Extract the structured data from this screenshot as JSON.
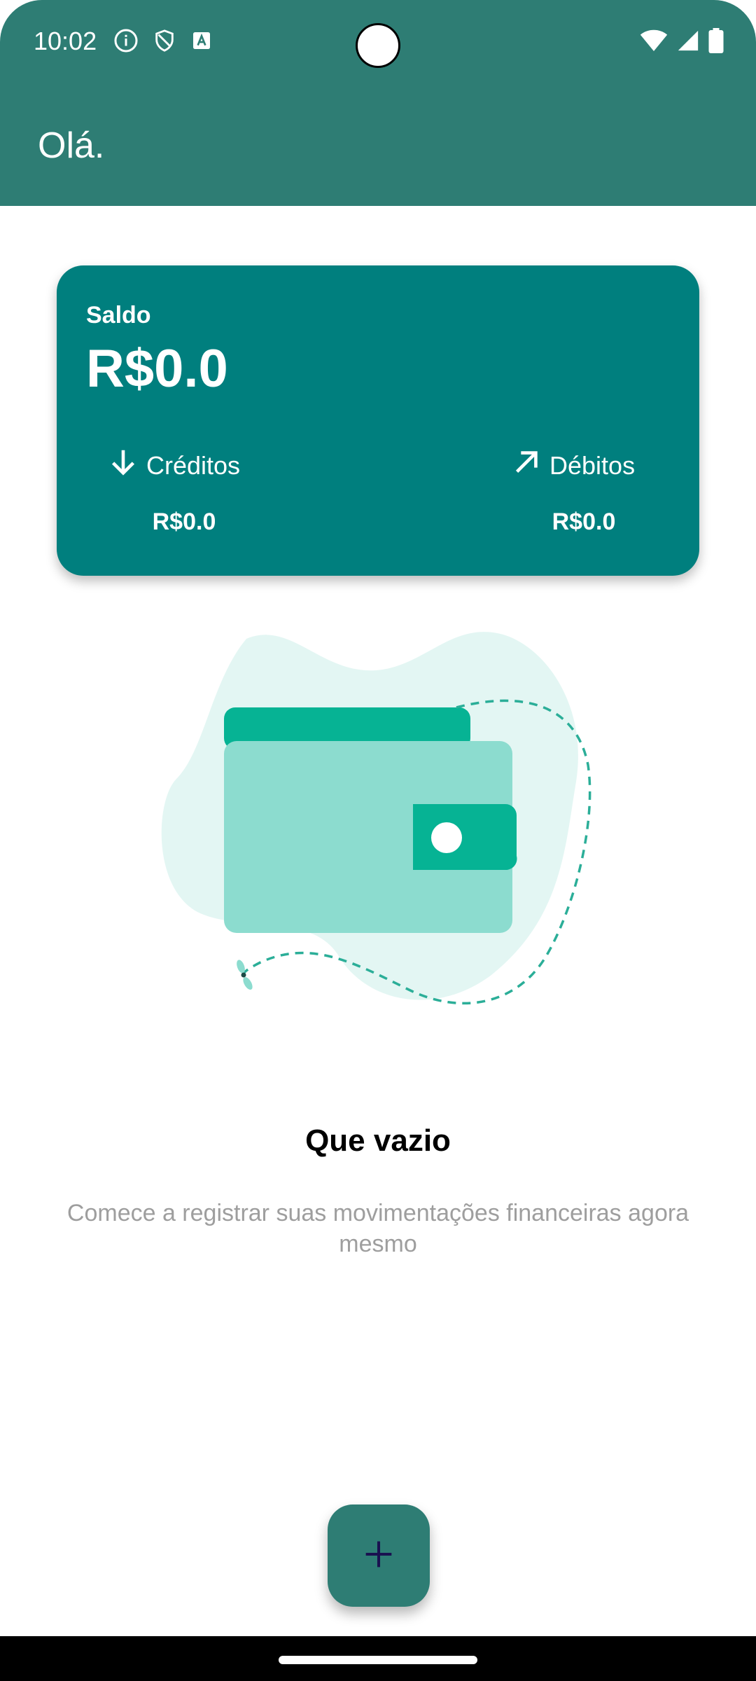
{
  "status_bar": {
    "time": "10:02",
    "left_icons": [
      "info-icon",
      "shield-icon",
      "text-a-icon"
    ],
    "right_icons": [
      "wifi-icon",
      "cell-signal-icon",
      "battery-icon"
    ]
  },
  "app_bar": {
    "title": "Olá."
  },
  "balance_card": {
    "label": "Saldo",
    "value": "R$0.0",
    "credits": {
      "label": "Créditos",
      "value": "R$0.0",
      "icon": "arrow-down-icon"
    },
    "debits": {
      "label": "Débitos",
      "value": "R$0.0",
      "icon": "arrow-up-right-icon"
    }
  },
  "empty_state": {
    "illustration": "wallet-icon",
    "title": "Que vazio",
    "subtitle": "Comece a registrar suas movimentações financeiras agora mesmo"
  },
  "fab": {
    "icon": "plus-icon"
  },
  "colors": {
    "primary": "#2e7d74",
    "card": "#007f7e",
    "wallet_dark": "#06b394",
    "wallet_light": "#8cdccf",
    "blob": "#e3f6f3",
    "fab_icon": "#1a1150"
  }
}
